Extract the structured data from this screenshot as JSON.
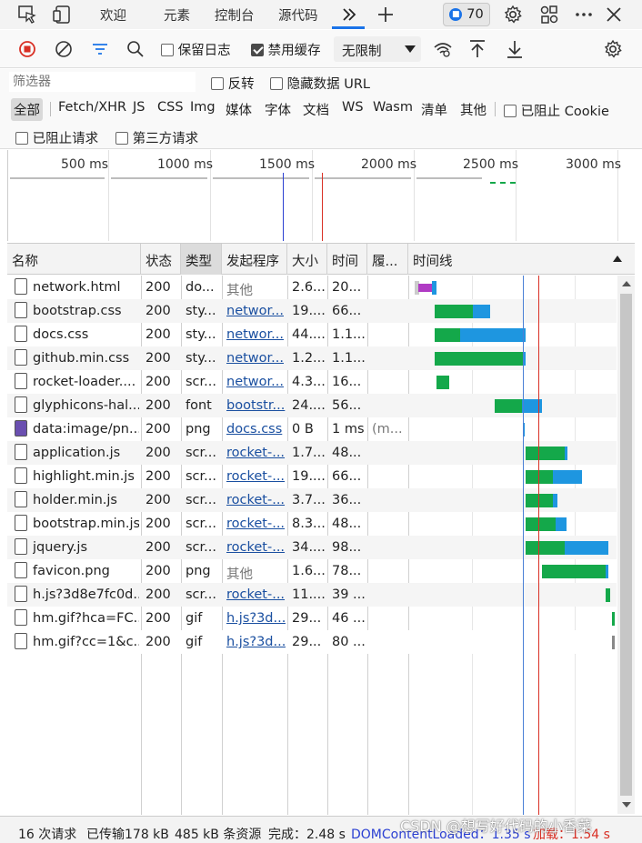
{
  "tabs": {
    "welcome": "欢迎",
    "elements": "元素",
    "console": "控制台",
    "sources": "源代码",
    "issues_count": "70"
  },
  "toolbar": {
    "preserve_log": "保留日志",
    "disable_cache": "禁用缓存",
    "throttling": "无限制"
  },
  "filter": {
    "placeholder": "筛选器",
    "invert": "反转",
    "hide_data_urls": "隐藏数据 URL",
    "types": [
      "全部",
      "Fetch/XHR",
      "JS",
      "CSS",
      "Img",
      "媒体",
      "字体",
      "文档",
      "WS",
      "Wasm",
      "清单",
      "其他"
    ],
    "blocked_cookies": "已阻止 Cookie",
    "blocked_requests": "已阻止请求",
    "third_party": "第三方请求"
  },
  "overview": {
    "ticks": [
      "500 ms",
      "1000 ms",
      "1500 ms",
      "2000 ms",
      "2500 ms",
      "3000 ms"
    ]
  },
  "table": {
    "headers": {
      "name": "名称",
      "status": "状态",
      "type": "类型",
      "initiator": "发起程序",
      "size": "大小",
      "time": "时间",
      "fulfilled": "履...",
      "waterfall": "时间线"
    },
    "rows": [
      {
        "name": "network.html",
        "status": "200",
        "type": "do...",
        "initiator": "其他",
        "initiator_link": false,
        "size": "2.6...",
        "time": "20...",
        "fulfilled": "",
        "icon": "doc"
      },
      {
        "name": "bootstrap.css",
        "status": "200",
        "type": "sty...",
        "initiator": "networ...",
        "initiator_link": true,
        "size": "19....",
        "time": "66...",
        "fulfilled": "",
        "icon": "doc"
      },
      {
        "name": "docs.css",
        "status": "200",
        "type": "sty...",
        "initiator": "networ...",
        "initiator_link": true,
        "size": "44....",
        "time": "1.1...",
        "fulfilled": "",
        "icon": "doc"
      },
      {
        "name": "github.min.css",
        "status": "200",
        "type": "sty...",
        "initiator": "networ...",
        "initiator_link": true,
        "size": "1.2...",
        "time": "1.1...",
        "fulfilled": "",
        "icon": "doc"
      },
      {
        "name": "rocket-loader....",
        "status": "200",
        "type": "scr...",
        "initiator": "networ...",
        "initiator_link": true,
        "size": "4.3...",
        "time": "16...",
        "fulfilled": "",
        "icon": "doc"
      },
      {
        "name": "glyphicons-hal...",
        "status": "200",
        "type": "font",
        "initiator": "bootstr...",
        "initiator_link": true,
        "size": "24....",
        "time": "56...",
        "fulfilled": "",
        "icon": "doc"
      },
      {
        "name": "data:image/pn...",
        "status": "200",
        "type": "png",
        "initiator": "docs.css",
        "initiator_link": true,
        "size": "0 B",
        "time": "1 ms",
        "fulfilled": "(m...",
        "icon": "img"
      },
      {
        "name": "application.js",
        "status": "200",
        "type": "scr...",
        "initiator": "rocket-...",
        "initiator_link": true,
        "size": "1.7...",
        "time": "48...",
        "fulfilled": "",
        "icon": "doc"
      },
      {
        "name": "highlight.min.js",
        "status": "200",
        "type": "scr...",
        "initiator": "rocket-...",
        "initiator_link": true,
        "size": "19....",
        "time": "66...",
        "fulfilled": "",
        "icon": "doc"
      },
      {
        "name": "holder.min.js",
        "status": "200",
        "type": "scr...",
        "initiator": "rocket-...",
        "initiator_link": true,
        "size": "3.7...",
        "time": "36...",
        "fulfilled": "",
        "icon": "doc"
      },
      {
        "name": "bootstrap.min.js",
        "status": "200",
        "type": "scr...",
        "initiator": "rocket-...",
        "initiator_link": true,
        "size": "8.3...",
        "time": "48...",
        "fulfilled": "",
        "icon": "doc"
      },
      {
        "name": "jquery.js",
        "status": "200",
        "type": "scr...",
        "initiator": "rocket-...",
        "initiator_link": true,
        "size": "34....",
        "time": "98...",
        "fulfilled": "",
        "icon": "doc"
      },
      {
        "name": "favicon.png",
        "status": "200",
        "type": "png",
        "initiator": "其他",
        "initiator_link": false,
        "size": "1.6...",
        "time": "78...",
        "fulfilled": "",
        "icon": "doc"
      },
      {
        "name": "h.js?3d8e7fc0d...",
        "status": "200",
        "type": "scr...",
        "initiator": "rocket-...",
        "initiator_link": true,
        "size": "11....",
        "time": "39 ...",
        "fulfilled": "",
        "icon": "doc"
      },
      {
        "name": "hm.gif?hca=FC...",
        "status": "200",
        "type": "gif",
        "initiator": "h.js?3d...",
        "initiator_link": true,
        "size": "29...",
        "time": "46 ...",
        "fulfilled": "",
        "icon": "doc"
      },
      {
        "name": "hm.gif?cc=1&c...",
        "status": "200",
        "type": "gif",
        "initiator": "h.js?3d...",
        "initiator_link": true,
        "size": "29...",
        "time": "80 ...",
        "fulfilled": "",
        "icon": "doc"
      }
    ]
  },
  "status": {
    "requests": "16 次请求",
    "transferred": "已传输178 kB",
    "resources": "485 kB 条资源",
    "finish": "完成：2.48 s",
    "dom_content_loaded": "DOMContentLoaded：1.35 s",
    "load": "加载：1.54 s"
  },
  "watermark": "CSDN @想写好代码的小香菜",
  "colors": {
    "accent": "#1a73e8",
    "waiting": "#14a84a",
    "download": "#1e96e0",
    "dcl_line": "#4a80d6",
    "load_line": "#d93025"
  }
}
